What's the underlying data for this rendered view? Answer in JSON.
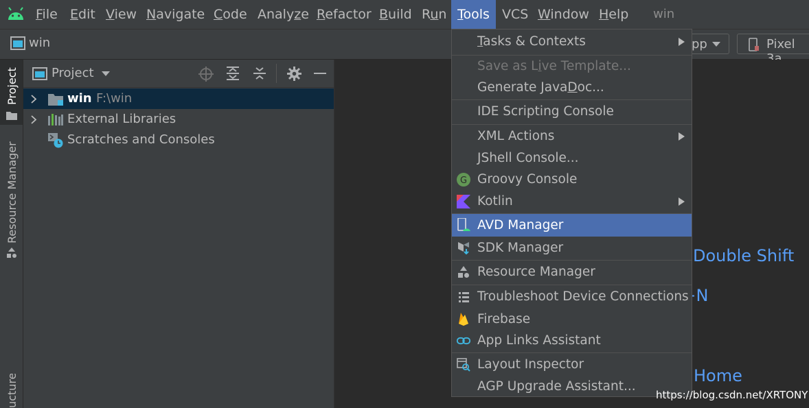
{
  "menubar": {
    "items": [
      {
        "pre": "",
        "mn": "F",
        "post": "ile"
      },
      {
        "pre": "",
        "mn": "E",
        "post": "dit"
      },
      {
        "pre": "",
        "mn": "V",
        "post": "iew"
      },
      {
        "pre": "",
        "mn": "N",
        "post": "avigate"
      },
      {
        "pre": "",
        "mn": "C",
        "post": "ode"
      },
      {
        "pre": "Analy",
        "mn": "z",
        "post": "e"
      },
      {
        "pre": "",
        "mn": "R",
        "post": "efactor"
      },
      {
        "pre": "",
        "mn": "B",
        "post": "uild"
      },
      {
        "pre": "R",
        "mn": "u",
        "post": "n"
      },
      {
        "pre": "",
        "mn": "T",
        "post": "ools"
      },
      {
        "pre": "VCS",
        "mn": "",
        "post": ""
      },
      {
        "pre": "",
        "mn": "W",
        "post": "indow"
      },
      {
        "pre": "",
        "mn": "H",
        "post": "elp"
      }
    ],
    "project_title": "win"
  },
  "navbar": {
    "breadcrumb": "win",
    "run_config_partial": "pp",
    "device_label": "Pixel 3a"
  },
  "toolstrip": {
    "project_tab": "Project",
    "resource_manager_tab": "Resource Manager",
    "structure_tab_partial": "ucture"
  },
  "project_panel": {
    "view_selector": "Project",
    "tree": [
      {
        "name": "win",
        "path": "F:\\win"
      },
      {
        "name": "External Libraries",
        "path": ""
      },
      {
        "name": "Scratches and Consoles",
        "path": ""
      }
    ]
  },
  "editor_hints": {
    "search_everywhere_shortcut": "Double Shift",
    "new_shortcut_partial": "t+N",
    "navbar_shortcut_partial": "Home"
  },
  "tools_menu": {
    "tasks": {
      "pre": "",
      "mn": "T",
      "post": "asks & Contexts"
    },
    "save_template": {
      "pre": "Save as L",
      "mn": "i",
      "post": "ve Template..."
    },
    "javadoc": {
      "pre": "Generate Java",
      "mn": "D",
      "post": "oc..."
    },
    "ide_scripting": "IDE Scripting Console",
    "xml_actions": "XML Actions",
    "jshell": "JShell Console...",
    "groovy": "Groovy Console",
    "kotlin": "Kotlin",
    "avd": "AVD Manager",
    "sdk": "SDK Manager",
    "resource_manager": "Resource Manager",
    "troubleshoot": "Troubleshoot Device Connections",
    "firebase": "Firebase",
    "app_links": "App Links Assistant",
    "layout_inspector": "Layout Inspector",
    "agp_upgrade": "AGP Upgrade Assistant..."
  },
  "watermark": "https://blog.csdn.net/XRTONY",
  "colors": {
    "accent": "#4b6eaf",
    "hint_blue": "#589df6",
    "android_green": "#3ddc84",
    "selection_tree": "#0d293e"
  }
}
